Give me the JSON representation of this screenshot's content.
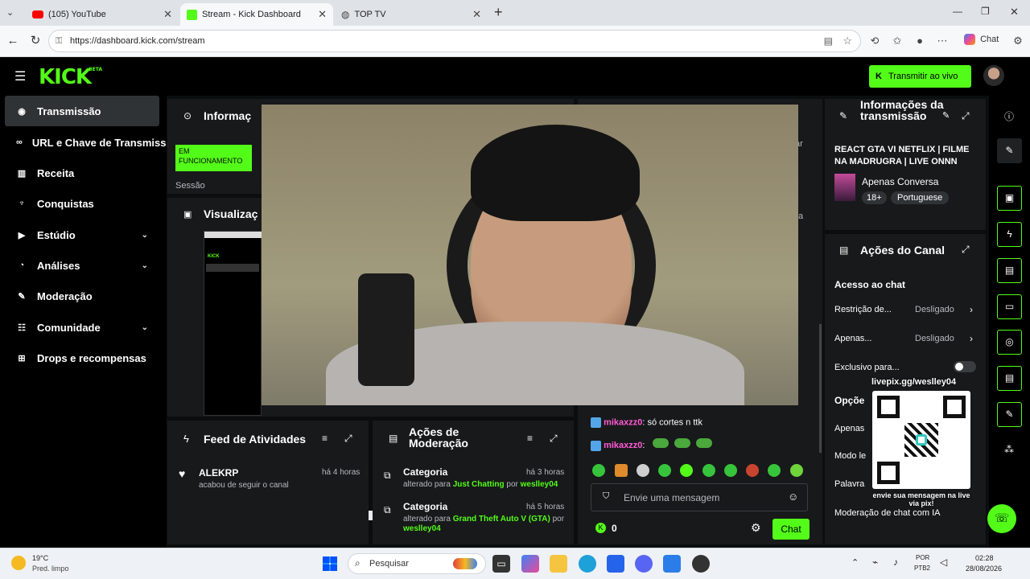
{
  "browser": {
    "tabs": [
      {
        "label": "(105) YouTube"
      },
      {
        "label": "Stream - Kick Dashboard"
      },
      {
        "label": "TOP TV"
      }
    ],
    "url": "https://dashboard.kick.com/stream",
    "copilot_label": "Chat"
  },
  "header": {
    "logo": "KICK",
    "logo_badge": "BETA",
    "go_live_label": "Transmitir ao vivo"
  },
  "sidebar": {
    "items": [
      {
        "label": "Transmissão"
      },
      {
        "label": "URL e Chave de Transmissão"
      },
      {
        "label": "Receita"
      },
      {
        "label": "Conquistas"
      },
      {
        "label": "Estúdio"
      },
      {
        "label": "Análises"
      },
      {
        "label": "Moderação"
      },
      {
        "label": "Comunidade"
      },
      {
        "label": "Drops e recompensas"
      }
    ]
  },
  "info_panel": {
    "title": "Informaç",
    "status_badge": "EM FUNCIONAMENTO",
    "session_label": "Sessão"
  },
  "preview_panel": {
    "title": "Visualizaç"
  },
  "activity_feed": {
    "title": "Feed de Atividades",
    "items": [
      {
        "user": "ALEKRP",
        "time": "há 4 horas",
        "action": "acabou de seguir o canal"
      }
    ]
  },
  "mod_actions": {
    "title": "Ações de Moderação",
    "items": [
      {
        "label": "Categoria",
        "time": "há 3 horas",
        "prefix": "alterado para",
        "value": "Just Chatting",
        "by": "por",
        "user": "weslley04"
      },
      {
        "label": "Categoria",
        "time": "há 5 horas",
        "prefix": "alterado para",
        "value": "Grand Theft Auto V (GTA)",
        "by": "por",
        "user": "weslley04"
      }
    ]
  },
  "chat": {
    "messages": [
      {
        "user": "mikaxzz0",
        "text": "só cortes n ttk"
      },
      {
        "user": "mikaxzz0",
        "text": ""
      }
    ],
    "input_placeholder": "Envie uma mensagem",
    "viewer_count": "0",
    "send_label": "Chat",
    "partial_right_a": "ar",
    "partial_right_b": "a"
  },
  "stream_info": {
    "title": "Informações da transmissão",
    "stream_title": "REACT GTA VI NETFLIX | FILME NA MADRUGRA | LIVE ONNN",
    "category": "Apenas Conversa",
    "tags": [
      "18+",
      "Portuguese"
    ]
  },
  "channel_actions": {
    "title": "Ações do Canal",
    "section": "Acesso ao chat",
    "rows": [
      {
        "label": "Restrição de...",
        "value": "Desligado"
      },
      {
        "label": "Apenas...",
        "value": "Desligado"
      }
    ],
    "exclusive_label": "Exclusivo para...",
    "options_label": "Opçõe",
    "partial_rows": [
      "Apenas",
      "Modo le",
      "Palavra",
      "Moderação de chat com IA"
    ]
  },
  "overlay": {
    "livepix_url": "livepix.gg/weslley04",
    "livepix_caption": "envie sua mensagem na live via pix!"
  },
  "taskbar": {
    "weather_temp": "19°C",
    "weather_desc": "Pred. limpo",
    "search_placeholder": "Pesquisar",
    "lang": "POR",
    "layout": "PTB2",
    "time": "02:28",
    "date": "28/08/2026"
  }
}
